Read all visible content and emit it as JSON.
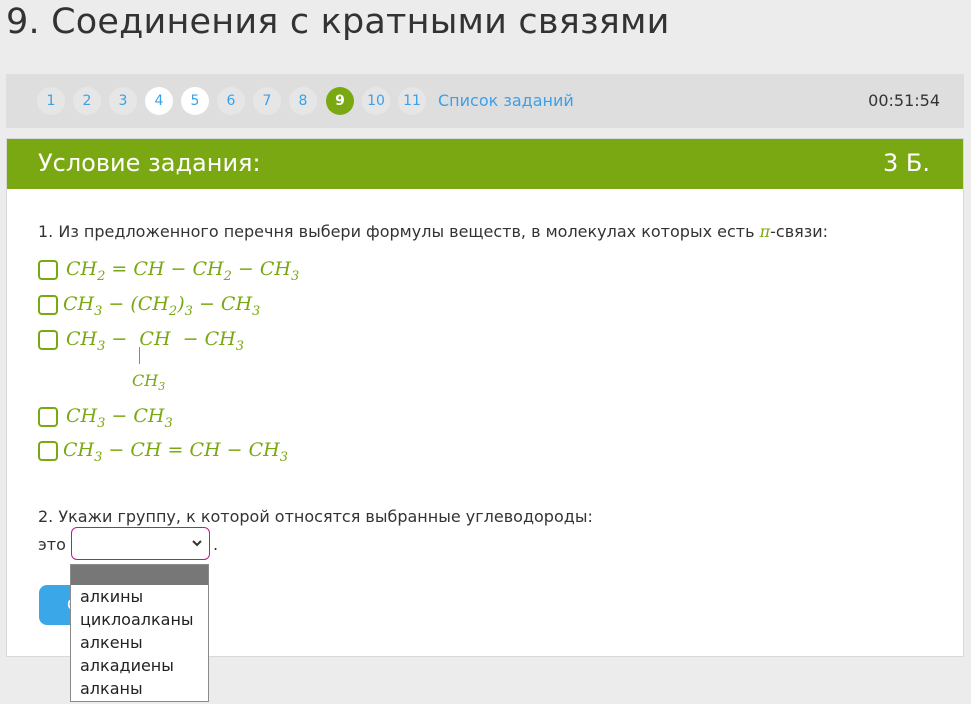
{
  "page_title": "9. Соединения с кратными связями",
  "nav": {
    "numbers": [
      "1",
      "2",
      "3",
      "4",
      "5",
      "6",
      "7",
      "8",
      "9",
      "10",
      "11"
    ],
    "task_list_link": "Список заданий",
    "timer": "00:51:54"
  },
  "card": {
    "header_title": "Условие задания:",
    "points": "3 Б."
  },
  "question1": {
    "text_before": "1. Из предложенного перечня выбери формулы веществ, в молекулах которых есть ",
    "pi": "π",
    "text_after": "-связи:"
  },
  "options": {
    "o1": {
      "a": "CH",
      "a_sub": "2",
      "b": " = CH − CH",
      "b_sub": "2",
      "c": " − CH",
      "c_sub": "3"
    },
    "o2": {
      "a": "CH",
      "a_sub": "3",
      "b": " − (CH",
      "b_sub": "2",
      "c": ")",
      "c_sub": "3",
      "d": " − CH",
      "d_sub": "3"
    },
    "o3": {
      "a": "CH",
      "a_sub": "3",
      "b": " −  CH  − CH",
      "b_sub": "3",
      "branch": "CH",
      "branch_sub": "3"
    },
    "o4": {
      "a": "CH",
      "a_sub": "3",
      "b": " − CH",
      "b_sub": "3"
    },
    "o5": {
      "a": "CH",
      "a_sub": "3",
      "b": " − CH = CH − CH",
      "b_sub": "3"
    }
  },
  "question2": {
    "text": "2. Укажи группу, к которой относятся выбранные углеводороды:",
    "prefix": "это",
    "suffix": ".",
    "submit_label": "С"
  },
  "dropdown": {
    "options": [
      "алкины",
      "циклоалканы",
      "алкены",
      "алкадиены",
      "алканы"
    ]
  },
  "colors": {
    "accent_green": "#7aa812",
    "link_blue": "#3aa0e8",
    "select_border": "#c4168c"
  },
  "icons": {
    "select_arrow": "chevron-down-icon"
  }
}
